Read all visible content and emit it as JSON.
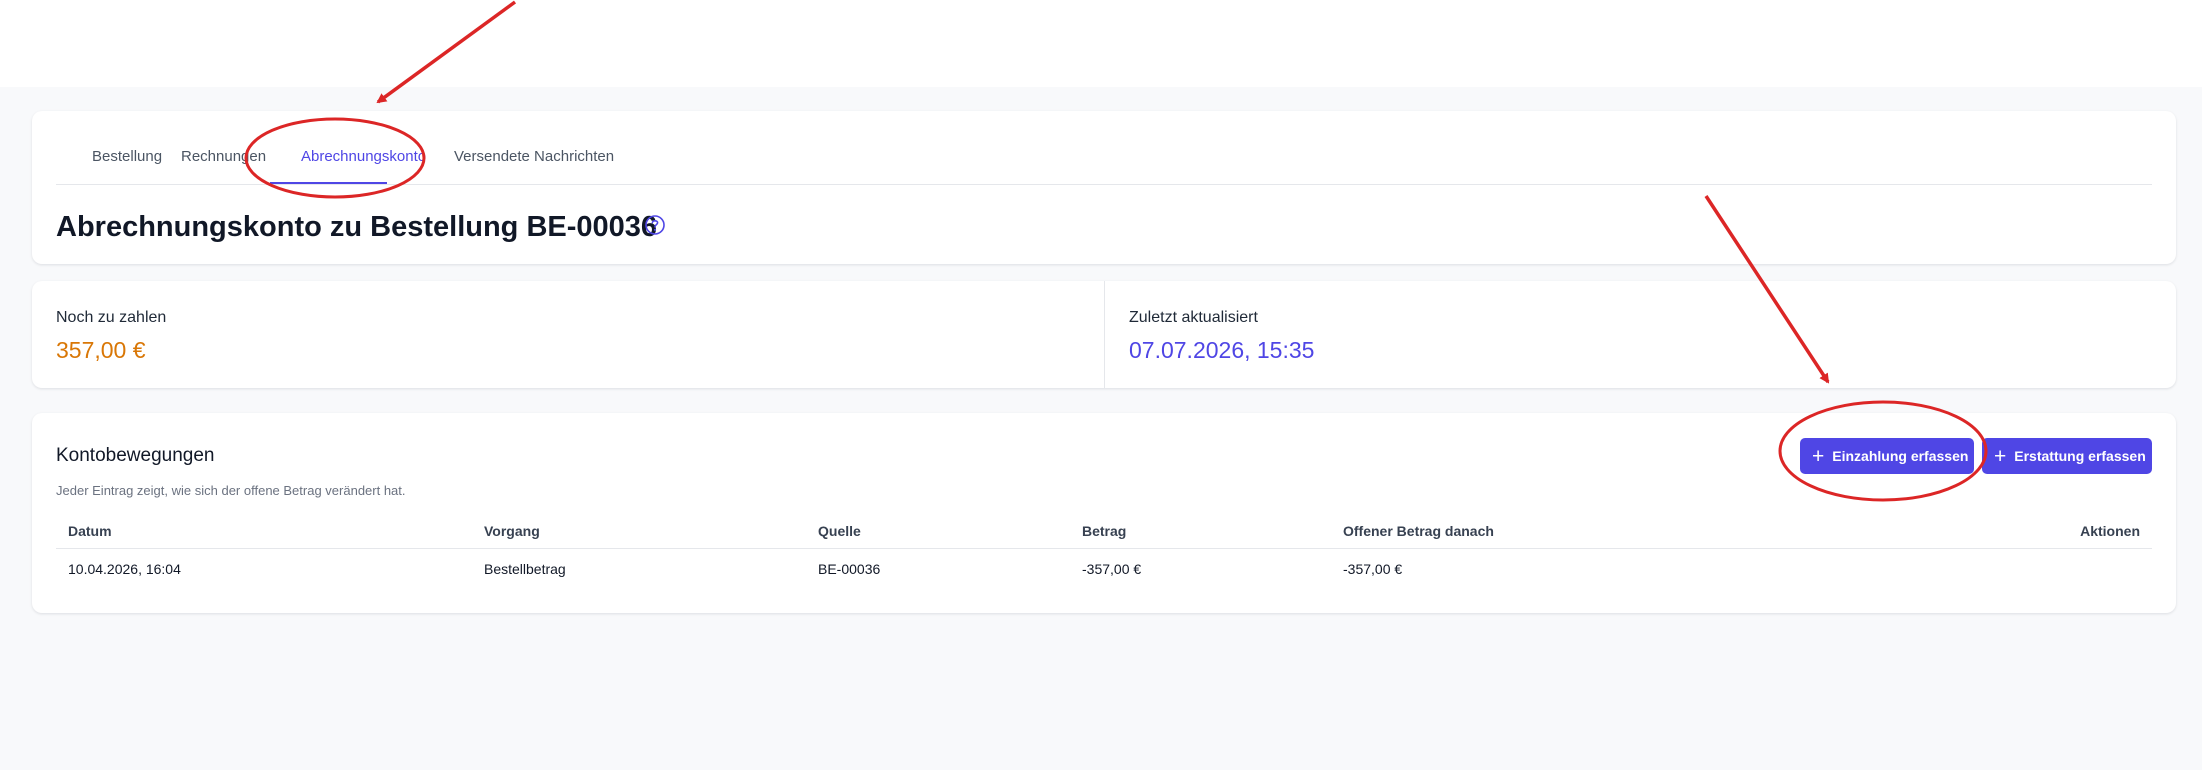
{
  "tabs": [
    {
      "label": "Bestellung",
      "active": false
    },
    {
      "label": "Rechnungen",
      "active": false
    },
    {
      "label": "Abrechnungskonto",
      "active": true
    },
    {
      "label": "Versendete Nachrichten",
      "active": false
    }
  ],
  "header": {
    "title": "Abrechnungskonto zu Bestellung BE-00036",
    "help_icon": "question-circle-icon"
  },
  "stats": {
    "due_label": "Noch zu zahlen",
    "due_value": "357,00 €",
    "updated_label": "Zuletzt aktualisiert",
    "updated_value": "07.07.2026, 15:35"
  },
  "movements": {
    "title": "Kontobewegungen",
    "subtitle": "Jeder Eintrag zeigt, wie sich der offene Betrag verändert hat.",
    "add_payment_label": "Einzahlung erfassen",
    "add_refund_label": "Erstattung erfassen",
    "columns": [
      "Datum",
      "Vorgang",
      "Quelle",
      "Betrag",
      "Offener Betrag danach",
      "Aktionen"
    ],
    "rows": [
      {
        "date": "10.04.2026, 16:04",
        "process": "Bestellbetrag",
        "source": "BE-00036",
        "amount": "-357,00 €",
        "open_after": "-357,00 €"
      }
    ]
  },
  "colors": {
    "accent": "#4f46e5",
    "due": "#d97706",
    "annotation": "#dc2626"
  }
}
